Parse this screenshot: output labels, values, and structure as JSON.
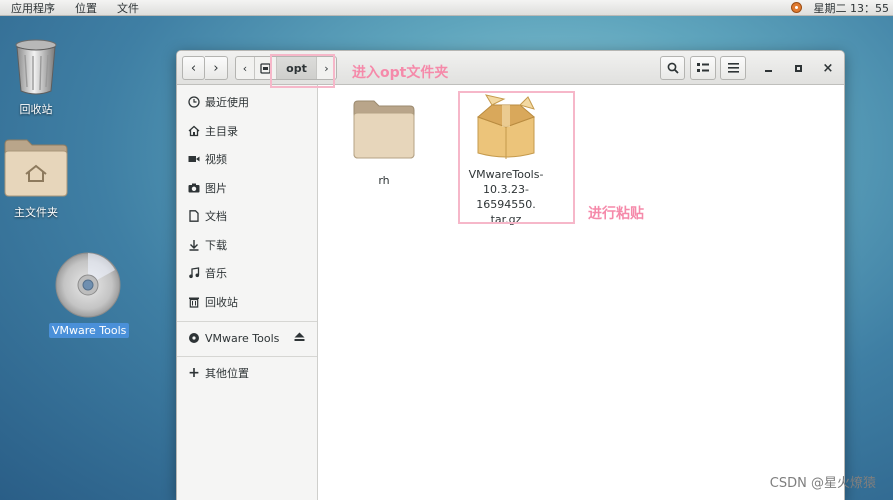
{
  "top_panel": {
    "menus": [
      "应用程序",
      "位置",
      "文件"
    ],
    "clock": "星期二 13：55"
  },
  "desktop": {
    "icons": [
      {
        "label": "回收站",
        "icon": "trash-icon"
      },
      {
        "label": "主文件夹",
        "icon": "home-folder-icon"
      },
      {
        "label": "VMware Tools",
        "icon": "cd-disc-icon",
        "selected": true
      }
    ]
  },
  "window": {
    "pathbar": {
      "current": "opt"
    },
    "sidebar": {
      "items": [
        {
          "label": "最近使用",
          "icon": "clock-icon"
        },
        {
          "label": "主目录",
          "icon": "home-icon"
        },
        {
          "label": "视频",
          "icon": "video-icon"
        },
        {
          "label": "图片",
          "icon": "camera-icon"
        },
        {
          "label": "文档",
          "icon": "document-icon"
        },
        {
          "label": "下载",
          "icon": "download-icon"
        },
        {
          "label": "音乐",
          "icon": "music-icon"
        },
        {
          "label": "回收站",
          "icon": "trash-icon"
        }
      ],
      "device": {
        "label": "VMware Tools",
        "icon": "disc-icon",
        "eject_icon": "eject-icon"
      },
      "other": {
        "label": "其他位置",
        "icon": "plus-icon"
      }
    },
    "files": [
      {
        "name": "rh",
        "type": "folder"
      },
      {
        "name_lines": [
          "VMwareTools-",
          "10.3.23-16594550.",
          "tar.gz"
        ],
        "type": "archive"
      }
    ]
  },
  "annotations": {
    "enter_opt": "进入opt文件夹",
    "paste": "进行粘贴"
  },
  "watermark": "CSDN @星火燎猿",
  "colors": {
    "annotation_pink": "#f58aaa",
    "selection_blue": "#4a90d9",
    "folder_tan": "#d9c4a4"
  }
}
